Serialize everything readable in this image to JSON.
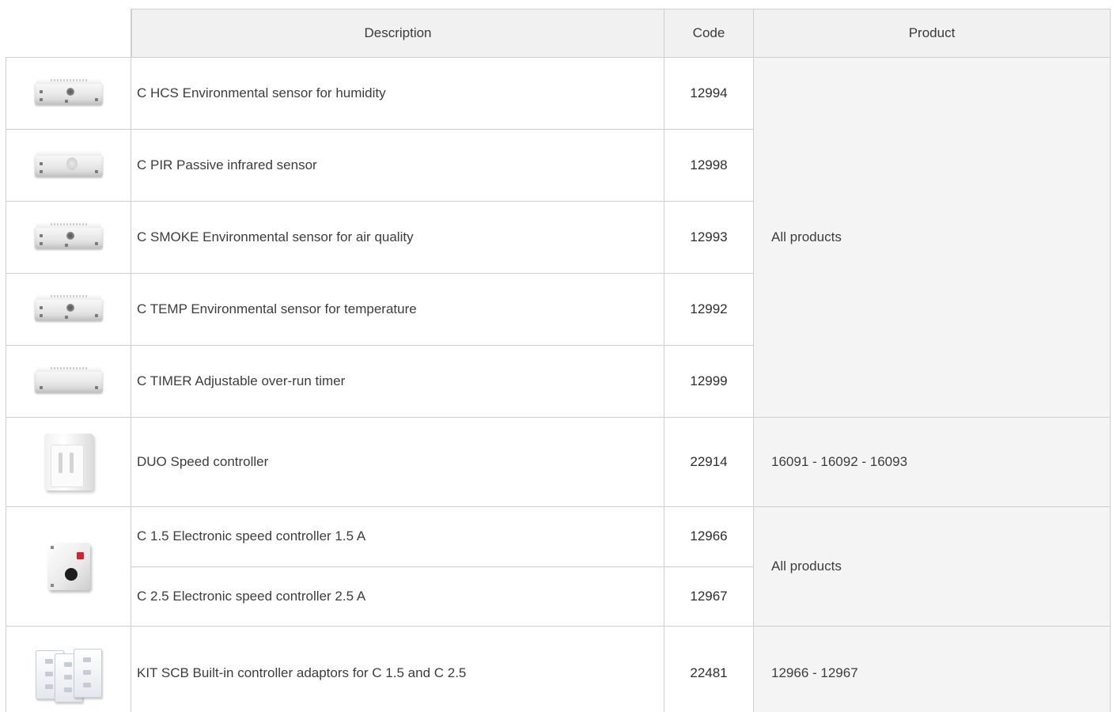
{
  "table": {
    "headers": {
      "description": "Description",
      "code": "Code",
      "product": "Product"
    },
    "rows": [
      {
        "description": "C HCS Environmental sensor for humidity",
        "code": "12994",
        "image": "humidity-sensor-image"
      },
      {
        "description": "C PIR Passive infrared sensor",
        "code": "12998",
        "image": "pir-sensor-image"
      },
      {
        "description": "C SMOKE Environmental sensor for air quality",
        "code": "12993",
        "image": "smoke-sensor-image"
      },
      {
        "description": "C TEMP Environmental sensor for temperature",
        "code": "12992",
        "image": "temperature-sensor-image"
      },
      {
        "description": "C TIMER Adjustable over-run timer",
        "code": "12999",
        "image": "timer-image"
      },
      {
        "description": "DUO Speed controller",
        "code": "22914",
        "image": "duo-speed-controller-image"
      },
      {
        "description": "C 1.5 Electronic speed controller 1.5 A",
        "code": "12966",
        "image": "electronic-speed-controller-image"
      },
      {
        "description": "C 2.5 Electronic speed controller 2.5 A",
        "code": "12967"
      },
      {
        "description": "KIT SCB Built-in controller adaptors for C 1.5 and C 2.5",
        "code": "22481",
        "image": "kit-scb-adaptors-image"
      }
    ],
    "product_groups": [
      {
        "label": "All products"
      },
      {
        "label": "16091 - 16092 - 16093"
      },
      {
        "label": "All products"
      },
      {
        "label": "12966 - 12967"
      }
    ]
  }
}
